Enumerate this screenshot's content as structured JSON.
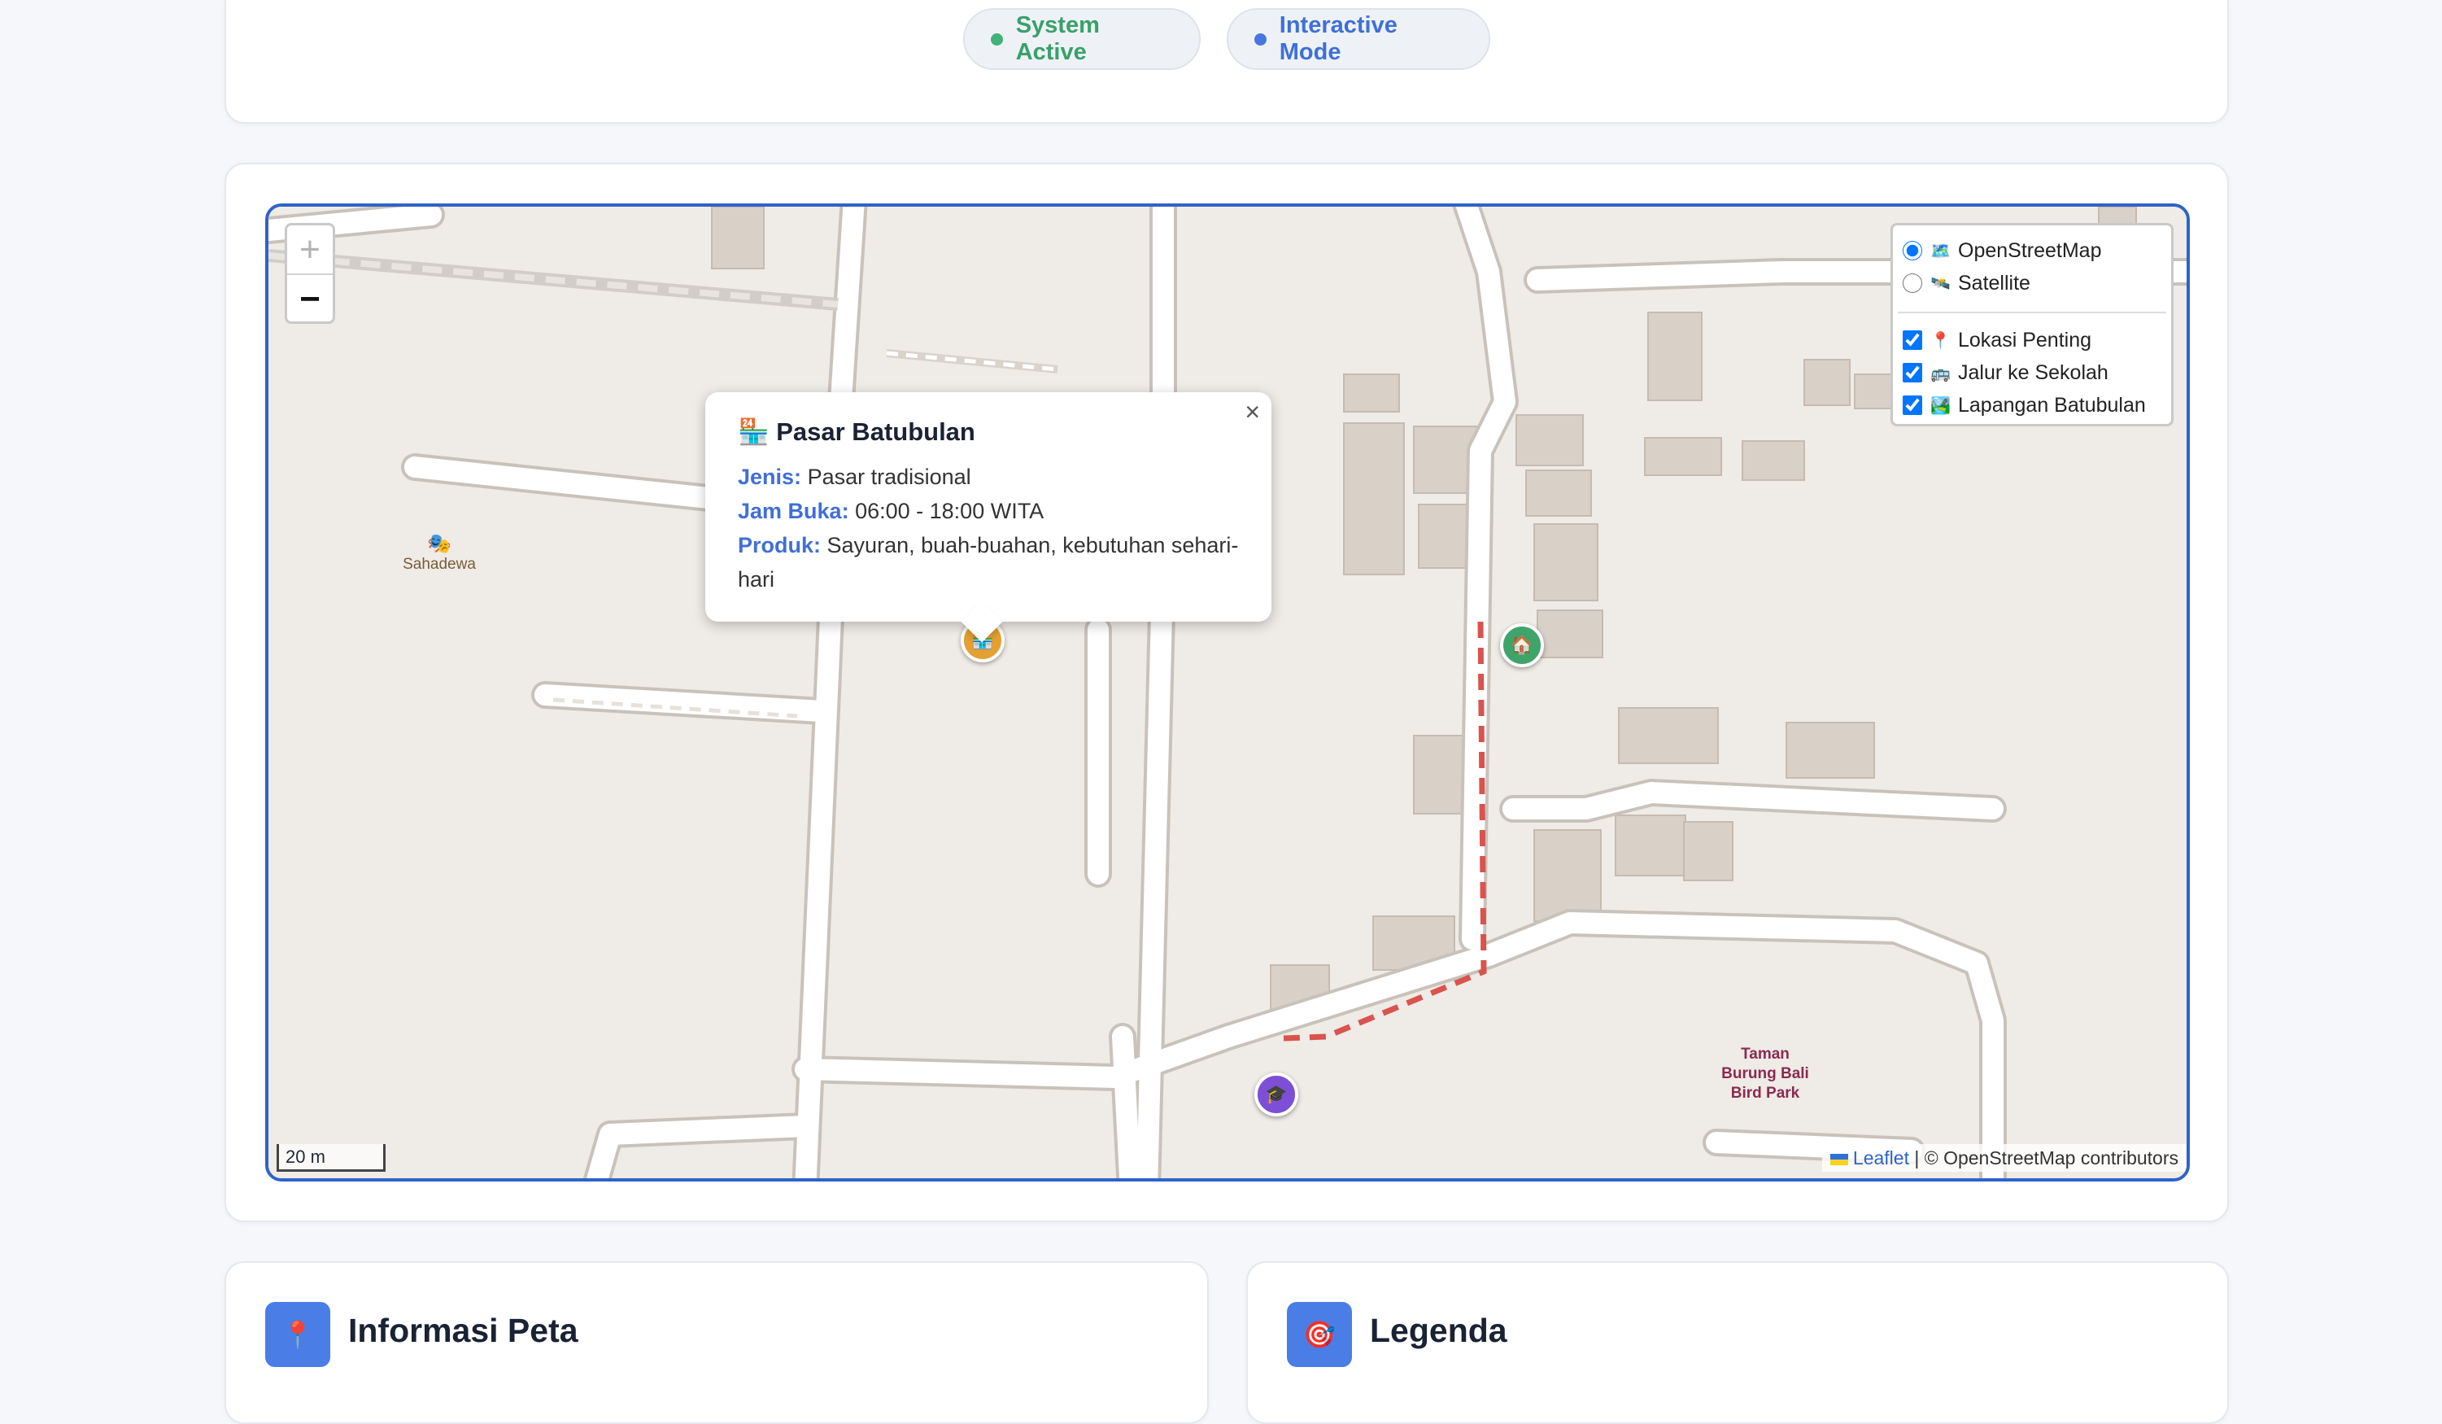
{
  "status": {
    "system_label": "System Active",
    "interactive_label": "Interactive Mode",
    "colors": {
      "system": "#3fb37a",
      "interactive": "#4a76e0"
    }
  },
  "map": {
    "zoom_in": "+",
    "zoom_out": "−",
    "layers": {
      "base": [
        {
          "label": "OpenStreetMap",
          "icon": "🗺️",
          "checked": true
        },
        {
          "label": "Satellite",
          "icon": "🛰️",
          "checked": false
        }
      ],
      "overlays": [
        {
          "label": "Lokasi Penting",
          "icon": "📍",
          "checked": true
        },
        {
          "label": "Jalur ke Sekolah",
          "icon": "🚌",
          "checked": true
        },
        {
          "label": "Lapangan Batubulan",
          "icon": "🏞️",
          "checked": true
        }
      ]
    },
    "popup": {
      "title": "Pasar Batubulan",
      "icon": "🏪",
      "close": "×",
      "rows": [
        {
          "label": "Jenis:",
          "value": "Pasar tradisional"
        },
        {
          "label": "Jam Buka:",
          "value": "06:00 - 18:00 WITA"
        },
        {
          "label": "Produk:",
          "value": "Sayuran, buah-buahan, kebutuhan sehari-hari"
        }
      ]
    },
    "markers": {
      "market": "🏪",
      "home": "🏠",
      "school": "🎓"
    },
    "poi": {
      "sahadewa": "Sahadewa",
      "sahadewa_icon": "🎭"
    },
    "park_label": "Taman Burung Bali Bird Park",
    "scale_label": "20 m",
    "attribution": {
      "leaflet": "Leaflet",
      "separator": "|",
      "osm": "© OpenStreetMap contributors"
    },
    "route_color": "#d9534f"
  },
  "sections": {
    "info": {
      "icon": "📍",
      "title": "Informasi Peta"
    },
    "legend": {
      "icon": "🎯",
      "title": "Legenda"
    }
  }
}
